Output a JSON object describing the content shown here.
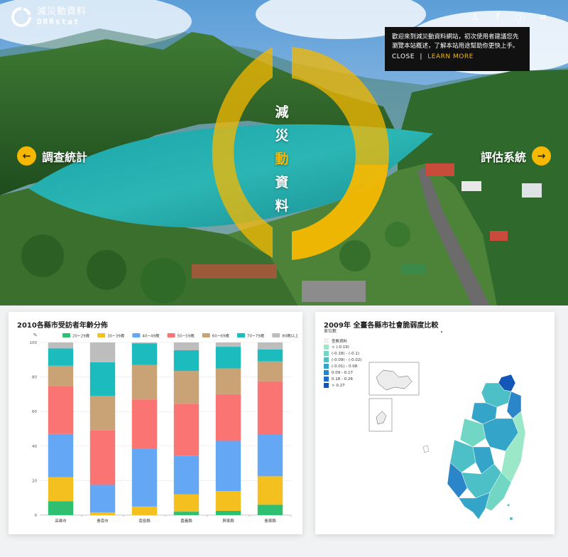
{
  "header": {
    "logo_cn": "減災動資料",
    "logo_en": "DRRstat",
    "icons": [
      "user-icon",
      "facebook-icon",
      "info-icon",
      "menu-icon"
    ],
    "icon_glyphs": [
      "♙",
      "f",
      "ⓘ",
      "≡"
    ]
  },
  "notice": {
    "text": "歡迎來到減災動資料網站，初次使用者建議您先瀏覽本站概述，了解本站用途幫助你更快上手。",
    "close_label": "CLOSE",
    "separator": "|",
    "learn_label": "LEARN MORE"
  },
  "hero": {
    "title_chars": [
      "減",
      "災",
      "動",
      "資",
      "料"
    ],
    "left_nav_label": "調查統計",
    "right_nav_label": "評估系統",
    "left_arrow": "←",
    "right_arrow": "→"
  },
  "colors": {
    "accent": "#f6b800"
  },
  "chart_data": [
    {
      "type": "bar",
      "stacked": true,
      "title": "2010各縣市受訪者年齡分佈",
      "ylabel": "%",
      "ylim": [
        0,
        100
      ],
      "yticks": [
        0,
        20,
        40,
        60,
        80,
        100
      ],
      "grid": true,
      "legend_position": "top",
      "categories": [
        "高雄市",
        "臺南市",
        "南投縣",
        "嘉義縣",
        "屏東縣",
        "臺東縣"
      ],
      "series": [
        {
          "name": "20~29歲",
          "color": "#2fbf71",
          "values": [
            8,
            0,
            0,
            2,
            2.5,
            6
          ]
        },
        {
          "name": "30~39歲",
          "color": "#f4c020",
          "values": [
            14,
            1.5,
            5,
            10,
            11.5,
            16.5
          ]
        },
        {
          "name": "40~49歲",
          "color": "#64a7f5",
          "values": [
            25,
            16,
            33.5,
            22.5,
            29,
            24
          ]
        },
        {
          "name": "50~59歲",
          "color": "#fb7474",
          "values": [
            27.5,
            31.5,
            28.5,
            30,
            27,
            31
          ]
        },
        {
          "name": "60~69歲",
          "color": "#c9a275",
          "values": [
            12,
            20,
            20,
            19,
            15,
            11.5
          ]
        },
        {
          "name": "70~79歲",
          "color": "#1cbbbd",
          "values": [
            10,
            19.5,
            12.5,
            12,
            12.5,
            7
          ]
        },
        {
          "name": "80歲以上",
          "color": "#bdbdbd",
          "values": [
            3.5,
            11.5,
            0.5,
            4.5,
            2.5,
            4
          ]
        }
      ]
    },
    {
      "type": "heatmap",
      "title": "2009年 全臺各縣市社會脆弱度比較",
      "unit_label": "單位數",
      "legend": [
        {
          "label": "查無資料",
          "color": "#f0f0f0"
        },
        {
          "label": "< (-0.19)",
          "color": "#9be8c8"
        },
        {
          "label": "(-0.18) - (-0.1)",
          "color": "#72d6c4"
        },
        {
          "label": "(-0.09) - (-0.02)",
          "color": "#4cc0c6"
        },
        {
          "label": "(-0.01) - 0.08",
          "color": "#35a4c9"
        },
        {
          "label": "0.09 - 0.17",
          "color": "#2a86c8"
        },
        {
          "label": "0.18 - 0.26",
          "color": "#1f6ec4"
        },
        {
          "label": "> 0.27",
          "color": "#1257b8"
        }
      ]
    }
  ]
}
